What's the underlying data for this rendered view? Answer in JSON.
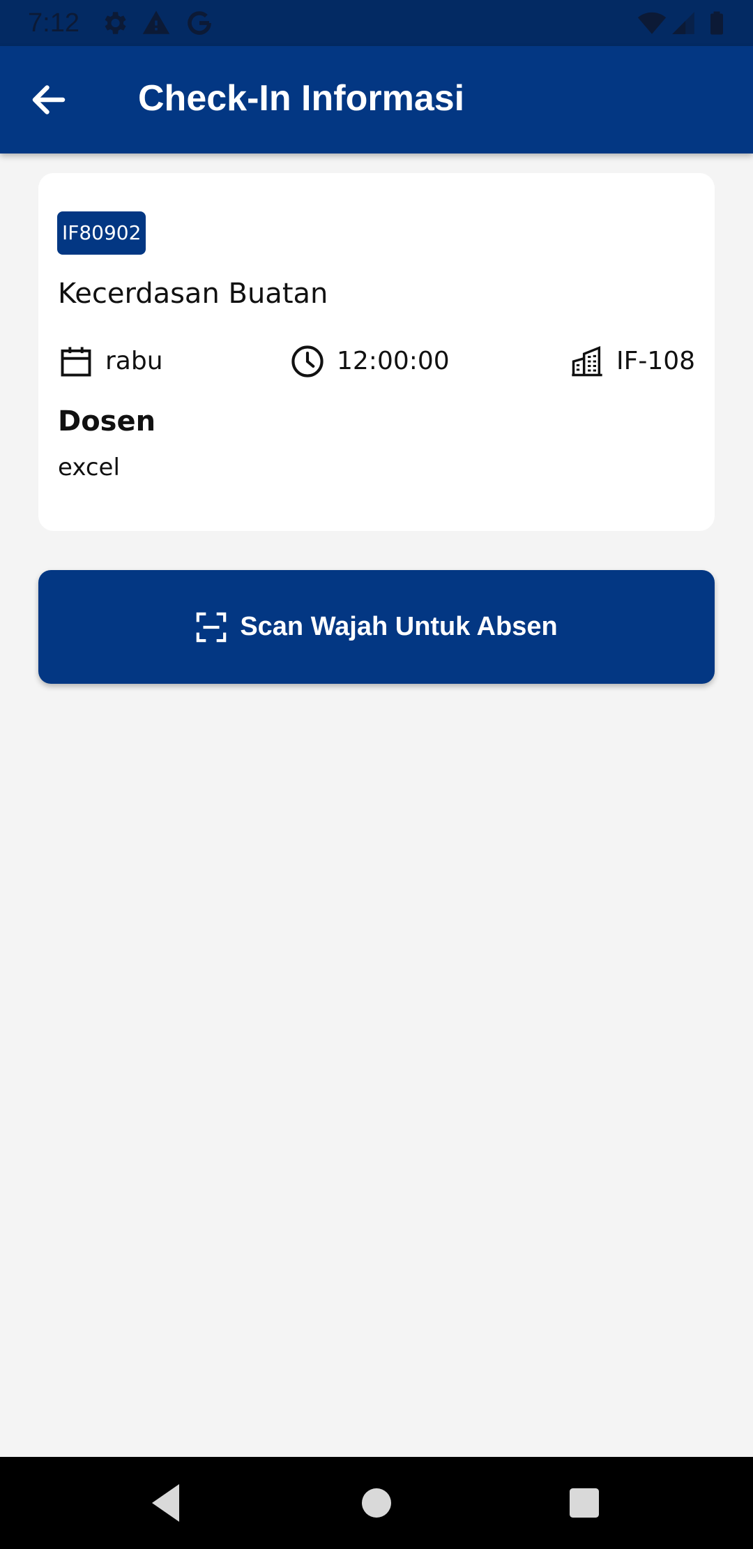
{
  "status_bar": {
    "time": "7:12",
    "icons": [
      "gear-icon",
      "warning-icon",
      "google-icon",
      "wifi-icon",
      "signal-icon",
      "battery-icon"
    ]
  },
  "app_bar": {
    "title": "Check-In Informasi",
    "back_icon": "arrow-back-icon"
  },
  "course": {
    "code": "IF80902",
    "name": "Kecerdasan Buatan",
    "day": "rabu",
    "time": "12:00:00",
    "room": "IF-108",
    "lecturer_heading": "Dosen",
    "lecturer": "excel"
  },
  "scan_button": {
    "label": "Scan Wajah Untuk Absen",
    "icon": "face-scan-icon"
  },
  "nav_bar": {
    "buttons": [
      "back-triangle-icon",
      "home-circle-icon",
      "recents-square-icon"
    ]
  },
  "colors": {
    "primary": "#033783",
    "status_bar": "#032a63",
    "background": "#f4f4f4",
    "card": "#ffffff"
  }
}
